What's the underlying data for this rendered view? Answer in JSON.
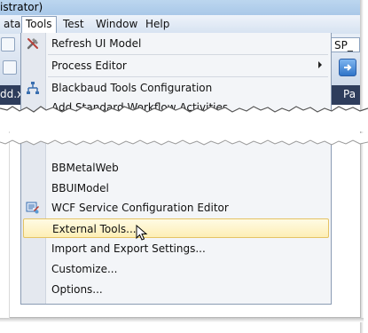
{
  "title_fragment": "istrator)",
  "menubar": {
    "left_fragment": "ata",
    "items": [
      {
        "label": "Tools"
      },
      {
        "label": "Test"
      },
      {
        "label": "Window"
      },
      {
        "label": "Help"
      }
    ]
  },
  "toolbar": {
    "combo_fragment": "SP_"
  },
  "tabs": {
    "left_fragment": "dd.x",
    "right_fragment": "Pa"
  },
  "menu_top": [
    {
      "label": "Refresh UI Model",
      "icon": "hammer-wrench-icon"
    },
    {
      "label": "Process Editor",
      "submenu": true
    },
    {
      "label": "Blackbaud Tools Configuration",
      "icon": "config-tree-icon"
    },
    {
      "label": "Add Standard Workflow Activities"
    }
  ],
  "menu_bottom": [
    {
      "label": "BBMetalWeb"
    },
    {
      "label": "BBUIModel"
    },
    {
      "label": "WCF Service Configuration Editor",
      "icon": "wcf-editor-icon"
    },
    {
      "label": "External Tools...",
      "highlighted": true
    },
    {
      "label": "Import and Export Settings..."
    },
    {
      "label": "Customize..."
    },
    {
      "label": "Options..."
    }
  ],
  "colors": {
    "highlight_fill": "#fdeeb5",
    "highlight_border": "#e5c365",
    "menu_background": "#f3f5f8",
    "gutter": "#e4e8ef"
  }
}
